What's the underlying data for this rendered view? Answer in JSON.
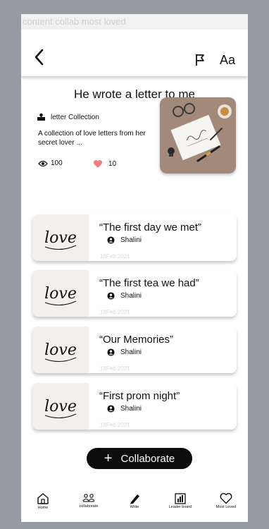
{
  "window": {
    "title": "content collab most loved"
  },
  "header": {
    "back_icon": "chevron-left-icon",
    "flag_icon": "flag-icon",
    "font_label": "Aa"
  },
  "story": {
    "title": "He wrote a letter to me",
    "collection": "letter Collection",
    "description": "A collection of love letters from her secret lover ...",
    "views": "100",
    "likes": "10"
  },
  "chapters": [
    {
      "title": "“The first day we met”",
      "author": "Shalini",
      "date": "18Feb 2021",
      "thumb_text": "love"
    },
    {
      "title": "“The first tea we had”",
      "author": "Shalini",
      "date": "18Feb 2021",
      "thumb_text": "love"
    },
    {
      "title": "“Our Memories”",
      "author": "Shalini",
      "date": "18Feb 2021",
      "thumb_text": "love"
    },
    {
      "title": "“First prom night”",
      "author": "Shalini",
      "date": "18Feb 2021",
      "thumb_text": "love"
    }
  ],
  "actions": {
    "collaborate_plus": "+",
    "collaborate": "Collaborate"
  },
  "nav": [
    {
      "icon": "home-icon",
      "label": "Home"
    },
    {
      "icon": "collaborate-icon",
      "label": "collaborate"
    },
    {
      "icon": "pen-icon",
      "label": "Write"
    },
    {
      "icon": "leaderboard-icon",
      "label": "Leader board"
    },
    {
      "icon": "heart-icon",
      "label": "Most Loved"
    }
  ],
  "colors": {
    "heart": "#f08080",
    "button": "#0c0c0c",
    "background": "#959ba3"
  }
}
